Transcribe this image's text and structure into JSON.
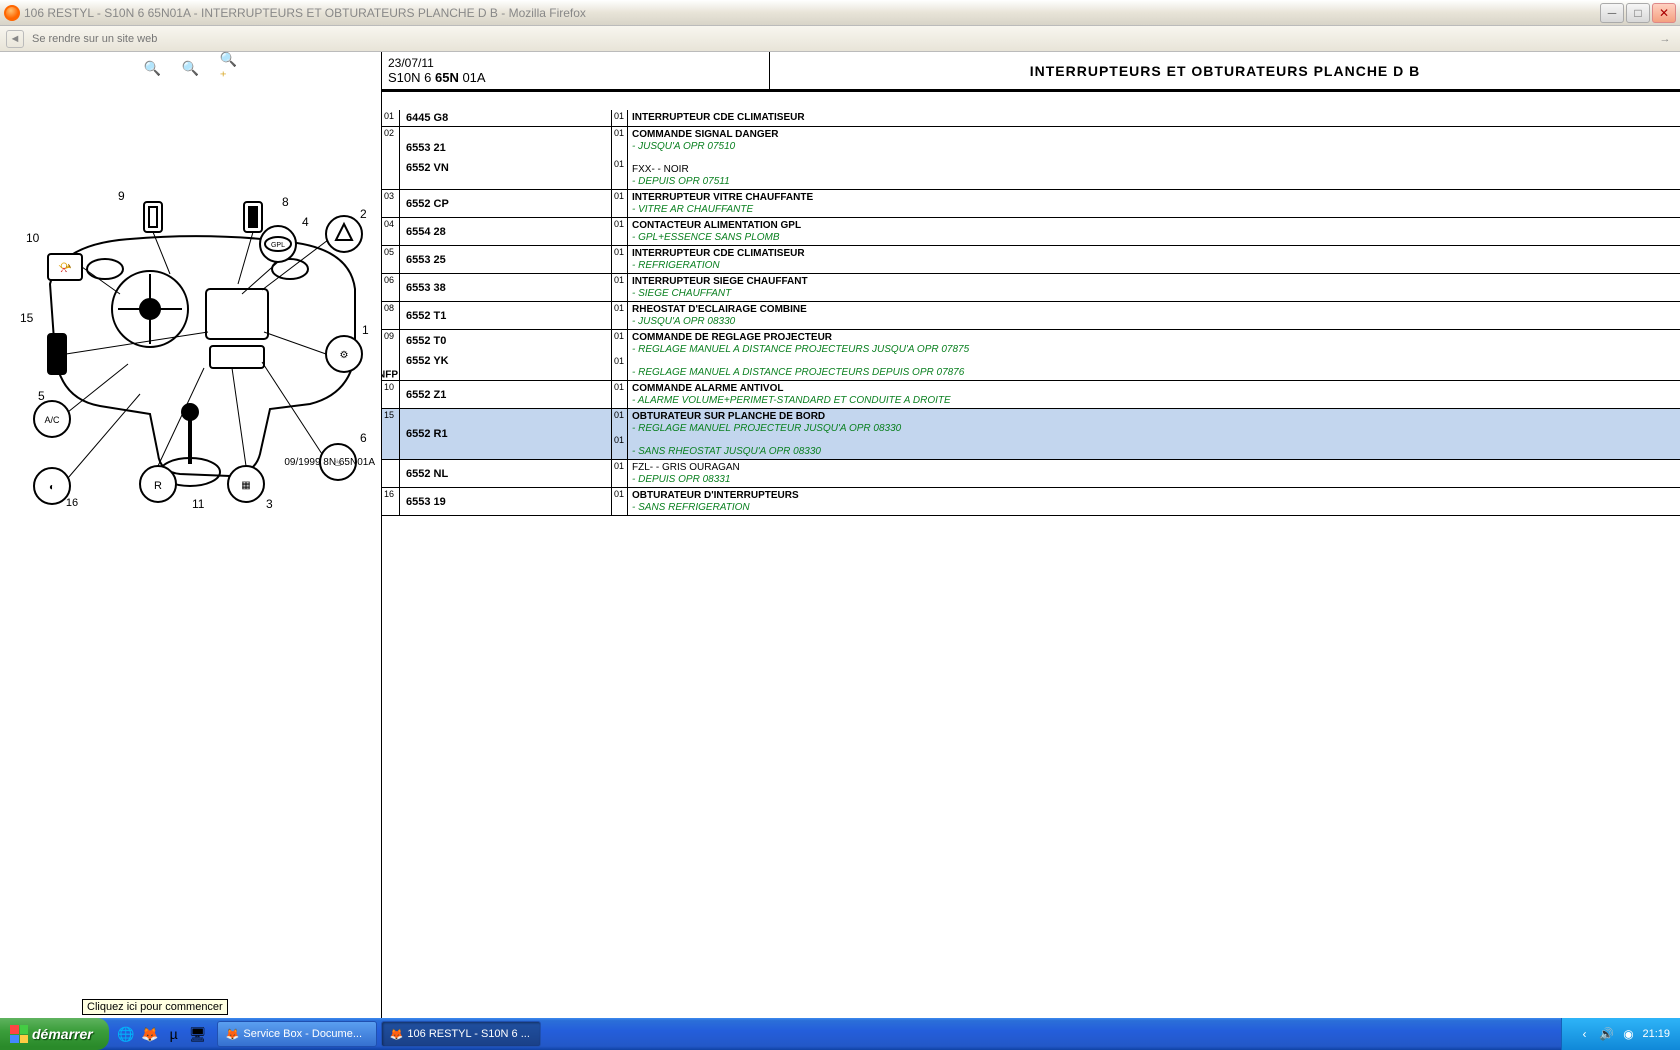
{
  "window": {
    "title": "106 RESTYL - S10N 6 65N01A - INTERRUPTEURS ET OBTURATEURS PLANCHE D B - Mozilla Firefox",
    "addressPlaceholder": "Se rendre sur un site web"
  },
  "header": {
    "date": "23/07/11",
    "codePrefix": "S10N 6 ",
    "codeBold": "65N",
    "codeSuffix": " 01A",
    "title": "INTERRUPTEURS ET OBTURATEURS PLANCHE D B"
  },
  "diagram": {
    "caption": "09/1999  8N 65N01A",
    "tooltip": "Cliquez ici pour commencer"
  },
  "parts": [
    {
      "num": "01",
      "refs": [
        "6445 G8"
      ],
      "qtys": [
        "01"
      ],
      "desc": [
        {
          "t": "title",
          "v": "INTERRUPTEUR CDE CLIMATISEUR"
        }
      ]
    },
    {
      "num": "02",
      "refs": [
        "6553 21",
        "6552 VN"
      ],
      "qtys": [
        "01",
        "01"
      ],
      "desc": [
        {
          "t": "title",
          "v": "COMMANDE SIGNAL DANGER"
        },
        {
          "t": "note",
          "v": "- JUSQU'A OPR 07510"
        },
        {
          "t": "gap"
        },
        {
          "t": "plain",
          "v": "FXX- - NOIR"
        },
        {
          "t": "note",
          "v": "- DEPUIS OPR 07511"
        }
      ]
    },
    {
      "num": "03",
      "refs": [
        "6552 CP"
      ],
      "qtys": [
        "01"
      ],
      "desc": [
        {
          "t": "title",
          "v": "INTERRUPTEUR VITRE CHAUFFANTE"
        },
        {
          "t": "note",
          "v": "- VITRE AR CHAUFFANTE"
        }
      ]
    },
    {
      "num": "04",
      "refs": [
        "6554 28"
      ],
      "qtys": [
        "01"
      ],
      "desc": [
        {
          "t": "title",
          "v": "CONTACTEUR ALIMENTATION GPL"
        },
        {
          "t": "note",
          "v": "- GPL+ESSENCE SANS PLOMB"
        }
      ]
    },
    {
      "num": "05",
      "refs": [
        "6553 25"
      ],
      "qtys": [
        "01"
      ],
      "desc": [
        {
          "t": "title",
          "v": "INTERRUPTEUR CDE CLIMATISEUR"
        },
        {
          "t": "note",
          "v": "- REFRIGERATION"
        }
      ]
    },
    {
      "num": "06",
      "refs": [
        "6553 38"
      ],
      "qtys": [
        "01"
      ],
      "desc": [
        {
          "t": "title",
          "v": "INTERRUPTEUR SIEGE CHAUFFANT"
        },
        {
          "t": "note",
          "v": "- SIEGE CHAUFFANT"
        }
      ]
    },
    {
      "num": "08",
      "refs": [
        "6552 T1"
      ],
      "qtys": [
        "01"
      ],
      "desc": [
        {
          "t": "title",
          "v": "RHEOSTAT D'ECLAIRAGE COMBINE"
        },
        {
          "t": "note",
          "v": "- JUSQU'A OPR 08330"
        }
      ]
    },
    {
      "num": "09",
      "nfp": "NFP",
      "refs": [
        "6552 T0",
        "6552 YK"
      ],
      "qtys": [
        "01",
        "01"
      ],
      "desc": [
        {
          "t": "title",
          "v": "COMMANDE DE REGLAGE PROJECTEUR"
        },
        {
          "t": "note",
          "v": "- REGLAGE MANUEL A DISTANCE PROJECTEURS JUSQU'A OPR 07875"
        },
        {
          "t": "gap"
        },
        {
          "t": "note",
          "v": "- REGLAGE MANUEL A DISTANCE PROJECTEURS DEPUIS OPR 07876"
        }
      ]
    },
    {
      "num": "10",
      "refs": [
        "6552 Z1"
      ],
      "qtys": [
        "01"
      ],
      "desc": [
        {
          "t": "title",
          "v": "COMMANDE ALARME ANTIVOL"
        },
        {
          "t": "note",
          "v": "- ALARME VOLUME+PERIMET-STANDARD ET CONDUITE A DROITE"
        }
      ]
    },
    {
      "num": "15",
      "selected": true,
      "refs": [
        "6552 R1"
      ],
      "qtys": [
        "01",
        "01"
      ],
      "desc": [
        {
          "t": "title",
          "v": "OBTURATEUR SUR PLANCHE DE BORD"
        },
        {
          "t": "note",
          "v": "- REGLAGE MANUEL PROJECTEUR JUSQU'A OPR 08330"
        },
        {
          "t": "gap"
        },
        {
          "t": "note",
          "v": "- SANS RHEOSTAT JUSQU'A OPR 08330"
        }
      ]
    },
    {
      "num": "",
      "refs": [
        "6552 NL"
      ],
      "qtys": [
        "01"
      ],
      "desc": [
        {
          "t": "plain",
          "v": "FZL- - GRIS OURAGAN"
        },
        {
          "t": "note",
          "v": "- DEPUIS OPR 08331"
        }
      ]
    },
    {
      "num": "16",
      "refs": [
        "6553 19"
      ],
      "qtys": [
        "01"
      ],
      "desc": [
        {
          "t": "title",
          "v": "OBTURATEUR D'INTERRUPTEURS"
        },
        {
          "t": "note",
          "v": "- SANS REFRIGERATION"
        }
      ]
    }
  ],
  "taskbar": {
    "start": "démarrer",
    "tasks": [
      {
        "label": "Service Box - Docume..."
      },
      {
        "label": "106 RESTYL - S10N 6 ...",
        "active": true
      }
    ],
    "clock": "21:19"
  }
}
